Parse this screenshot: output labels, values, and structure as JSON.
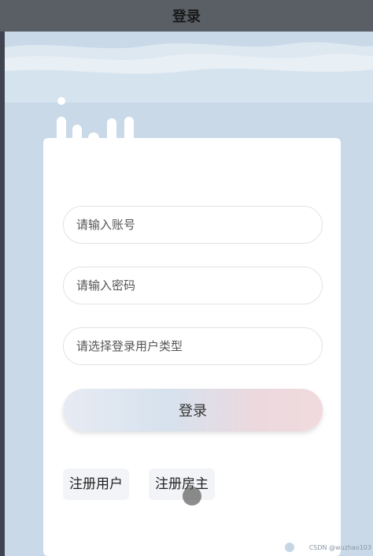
{
  "header": {
    "title": "登录"
  },
  "form": {
    "account_placeholder": "请输入账号",
    "password_placeholder": "请输入密码",
    "user_type_placeholder": "请选择登录用户类型",
    "login_label": "登录"
  },
  "links": {
    "register_user": "注册用户",
    "register_landlord": "注册房主"
  },
  "watermark": "CSDN @wuzhao103",
  "colors": {
    "background": "#c9d9e8",
    "card": "#ffffff",
    "topbar": "#5a5f66"
  }
}
